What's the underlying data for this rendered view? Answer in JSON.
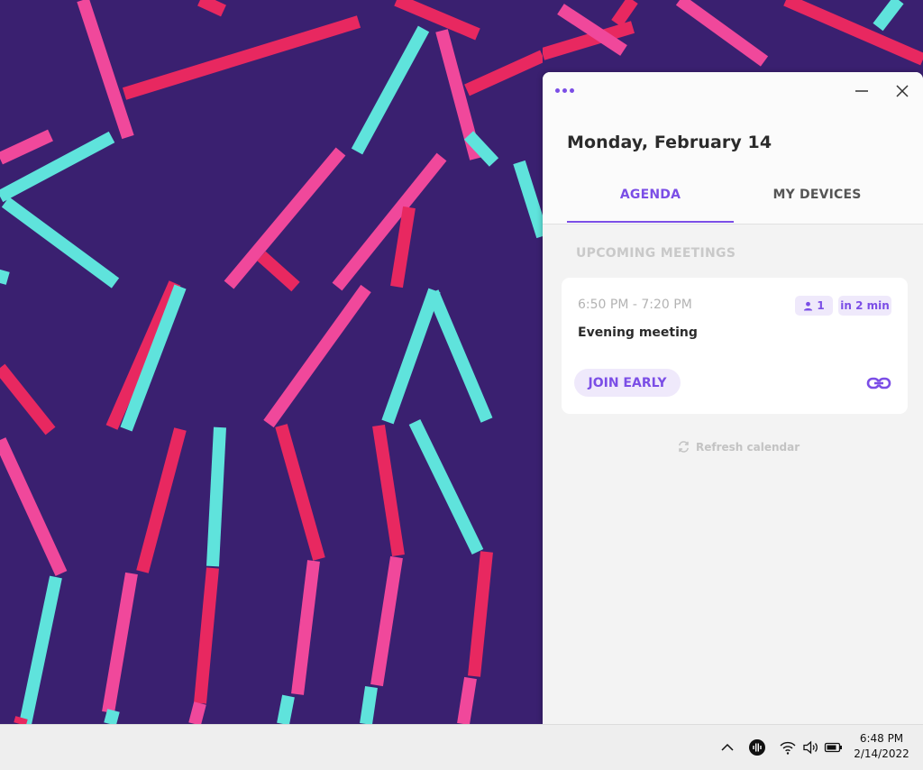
{
  "app": {
    "date_title": "Monday, February 14",
    "tabs": [
      {
        "label": "AGENDA",
        "active": true
      },
      {
        "label": "MY DEVICES",
        "active": false
      }
    ],
    "section_title": "UPCOMING MEETINGS",
    "meeting": {
      "time": "6:50 PM - 7:20 PM",
      "attendees": "1",
      "countdown": "in 2 min",
      "title": "Evening meeting",
      "join_label": "JOIN EARLY"
    },
    "refresh_label": "Refresh calendar",
    "accent_color": "#7b4ee6"
  },
  "taskbar": {
    "time": "6:48 PM",
    "date": "2/14/2022"
  },
  "wallpaper_colors": {
    "background": "#3a2070",
    "cyan": "#5fe3dc",
    "pink": "#f0489b",
    "red": "#e82860"
  }
}
